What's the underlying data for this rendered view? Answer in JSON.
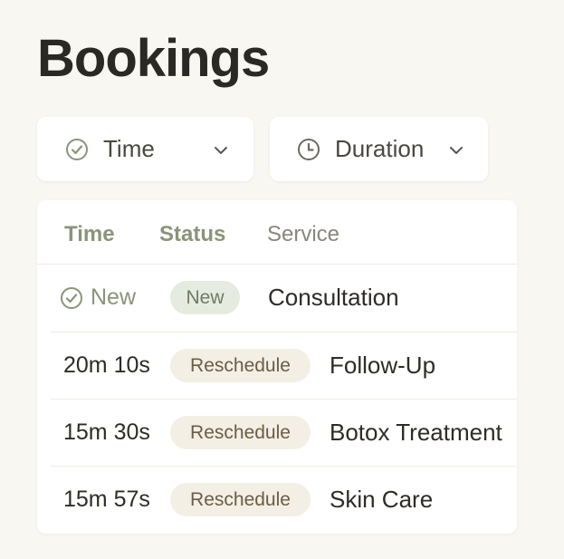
{
  "page": {
    "title": "Bookings"
  },
  "filters": {
    "time": {
      "label": "Time",
      "icon": "check-circle-icon"
    },
    "duration": {
      "label": "Duration",
      "icon": "clock-icon"
    }
  },
  "table": {
    "headers": {
      "time": "Time",
      "status": "Status",
      "service": "Service"
    },
    "rows": [
      {
        "time": "New",
        "status": "New",
        "service": "Consultation"
      },
      {
        "time": "20m 10s",
        "status": "Reschedule",
        "service": "Follow-Up"
      },
      {
        "time": "15m 30s",
        "status": "Reschedule",
        "service": "Botox Treatment"
      },
      {
        "time": "15m 57s",
        "status": "Reschedule",
        "service": "Skin Care"
      }
    ]
  },
  "colors": {
    "accent_green": "#8a9479",
    "new_badge_bg": "#e6ebe0",
    "reschedule_badge_bg": "#f3efe4",
    "page_bg": "#f9f7f2"
  }
}
